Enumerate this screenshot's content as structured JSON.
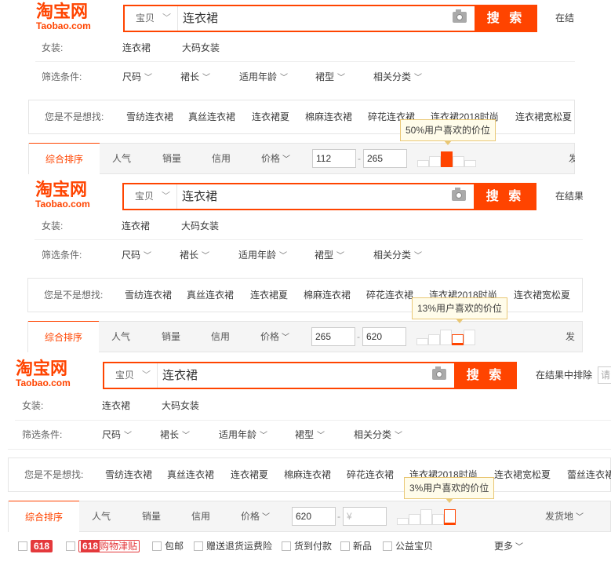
{
  "logo": {
    "cn": "淘宝网",
    "en": "Taobao.com"
  },
  "brand_color": "#ff4400",
  "search": {
    "category": "宝贝",
    "query": "连衣裙",
    "button": "搜 索",
    "camera_icon": "camera-icon"
  },
  "in_result": {
    "short": "在结",
    "medium": "在结果",
    "full": "在结果中排除",
    "placeholder": "请"
  },
  "women": {
    "label": "女装:",
    "items": [
      "连衣裙",
      "大码女装"
    ]
  },
  "filter_conditions": {
    "label": "筛选条件:",
    "items": [
      "尺码",
      "裙长",
      "适用年龄",
      "裙型",
      "相关分类"
    ]
  },
  "suggest": {
    "label": "您是不是想找:",
    "items": [
      "雪纺连衣裙",
      "真丝连衣裙",
      "连衣裙夏",
      "棉麻连衣裙",
      "碎花连衣裙",
      "连衣裙2018时尚",
      "连衣裙宽松夏",
      "蕾丝连衣裙"
    ]
  },
  "sort": {
    "active": "综合排序",
    "items": [
      "人气",
      "销量",
      "信用",
      "价格"
    ],
    "ship_short": "发",
    "ship_medium": "发货",
    "ship_full": "发货地"
  },
  "panels": [
    {
      "price_min": "112",
      "price_max": "265",
      "tip": "50%用户喜欢的价位",
      "selected_bar": 2
    },
    {
      "price_min": "265",
      "price_max": "620",
      "tip": "13%用户喜欢的价位",
      "selected_bar": 3
    },
    {
      "price_min": "620",
      "price_max_placeholder": "¥",
      "tip": "3%用户喜欢的价位",
      "selected_bar": 4
    }
  ],
  "bottom_filters": {
    "badge618": "618",
    "badge618_sub": "购物津贴",
    "items": [
      "包邮",
      "赠送退货运费险",
      "货到付款",
      "新品",
      "公益宝贝"
    ],
    "more": "更多"
  }
}
